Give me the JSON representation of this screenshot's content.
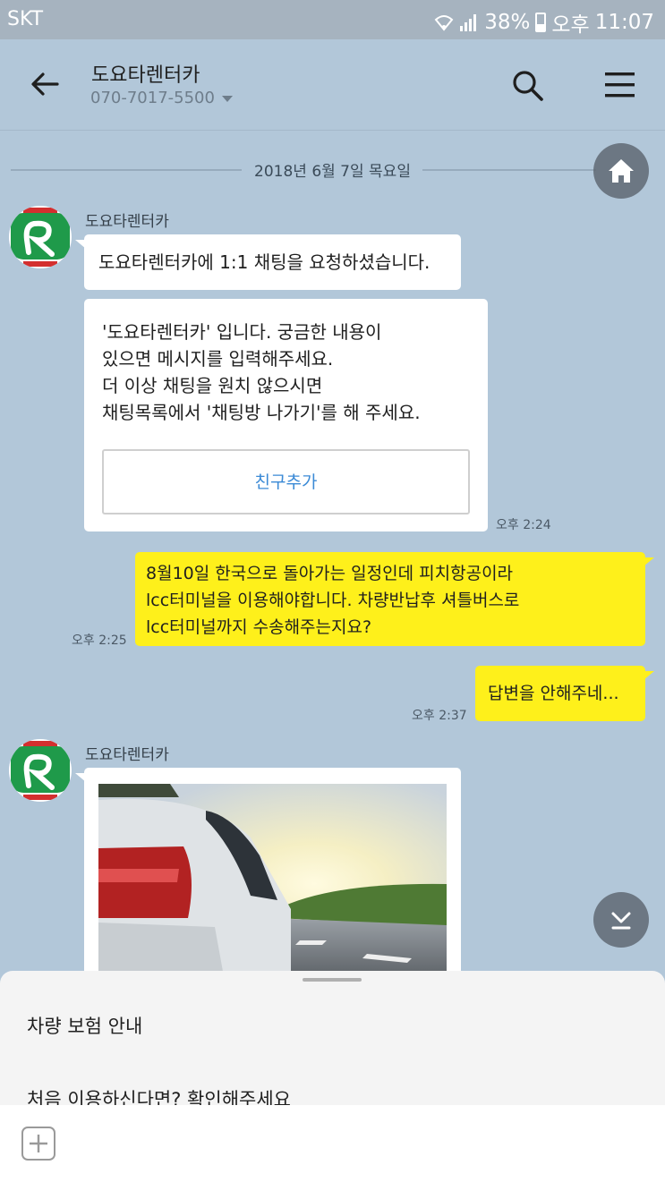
{
  "status_bar": {
    "carrier": "SKT",
    "battery": "38%",
    "ampm": "오후",
    "time": "11:07"
  },
  "header": {
    "title": "도요타렌터카",
    "phone": "070-7017-5500"
  },
  "date_divider": "2018년 6월 7일 목요일",
  "messages": {
    "m1": {
      "sender": "도요타렌터카",
      "text": "도요타렌터카에 1:1 채팅을 요청하셨습니다."
    },
    "m2": {
      "line1": "'도요타렌터카' 입니다.  궁금한 내용이",
      "line2": "있으면 메시지를 입력해주세요.",
      "line3": "더 이상 채팅을 원치 않으시면",
      "line4": "채팅목록에서 '채팅방 나가기'를 해 주세요.",
      "button": "친구추가",
      "time": "오후 2:24"
    },
    "m3": {
      "line1": "8월10일 한국으로 돌아가는 일정인데 피치항공이라",
      "line2": "lcc터미널을 이용해야합니다. 차량반납후 셔틀버스로",
      "line3": "lcc터미널까지 수송해주는지요?",
      "time": "오후 2:25"
    },
    "m4": {
      "text": "답변을 안해주네...",
      "time": "오후 2:37"
    },
    "m5": {
      "sender": "도요타렌터카"
    }
  },
  "bottom_sheet": {
    "item1": "차량 보험 안내",
    "item2": "처음 이용하신다면? 확인해주세요"
  },
  "colors": {
    "background": "#b2c7d9",
    "my_bubble": "#fef01b",
    "accent": "#3b8ad6"
  }
}
